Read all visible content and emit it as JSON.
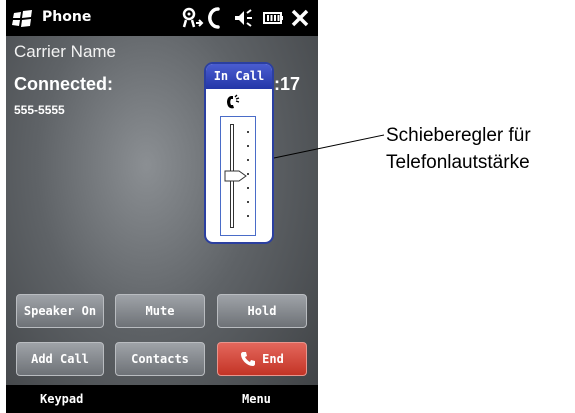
{
  "statusbar": {
    "title": "Phone",
    "icons": [
      "windows-start-icon",
      "signal-roaming-icon",
      "phone-call-icon",
      "speaker-volume-icon",
      "battery-icon",
      "close-icon"
    ]
  },
  "call": {
    "carrier": "Carrier Name",
    "status": "Connected:",
    "duration": "0:17",
    "duration_visible": ":17",
    "number": "555-5555"
  },
  "volume_popup": {
    "title": "In Call",
    "icon": "phone-volume-icon",
    "level": 0.5
  },
  "buttons": {
    "speaker": "Speaker On",
    "mute": "Mute",
    "hold": "Hold",
    "add_call": "Add Call",
    "contacts": "Contacts",
    "end": "End"
  },
  "softkeys": {
    "left": "Keypad",
    "right": "Menu"
  },
  "callout": {
    "line1": "Schieberegler für",
    "line2": "Telefonlautstärke"
  },
  "colors": {
    "end_button": "#d9463a",
    "popup_header": "#2f43b6",
    "bars": "#000000"
  }
}
